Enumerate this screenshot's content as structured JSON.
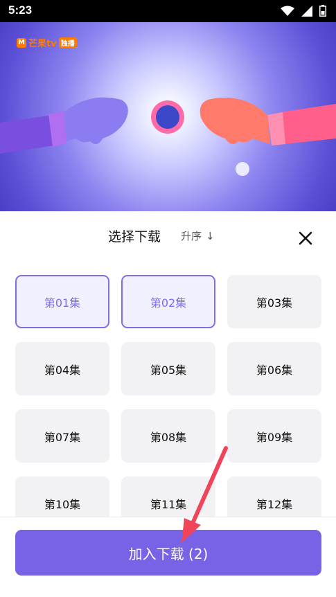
{
  "status_bar": {
    "time": "5:23"
  },
  "video": {
    "logo_text": "芒果tv",
    "logo_badge": "独播"
  },
  "sheet": {
    "title": "选择下载",
    "sort_label": "升序",
    "sort_arrow": "↓",
    "episodes": [
      {
        "label": "第01集",
        "selected": true
      },
      {
        "label": "第02集",
        "selected": true
      },
      {
        "label": "第03集",
        "selected": false
      },
      {
        "label": "第04集",
        "selected": false
      },
      {
        "label": "第05集",
        "selected": false
      },
      {
        "label": "第06集",
        "selected": false
      },
      {
        "label": "第07集",
        "selected": false
      },
      {
        "label": "第08集",
        "selected": false
      },
      {
        "label": "第09集",
        "selected": false
      },
      {
        "label": "第10集",
        "selected": false
      },
      {
        "label": "第11集",
        "selected": false
      },
      {
        "label": "第12集",
        "selected": false
      }
    ],
    "add_button_label": "加入下载 (2)"
  },
  "colors": {
    "accent": "#7863e6",
    "selected_border": "#7d6ee6",
    "arrow": "#f0445a"
  }
}
